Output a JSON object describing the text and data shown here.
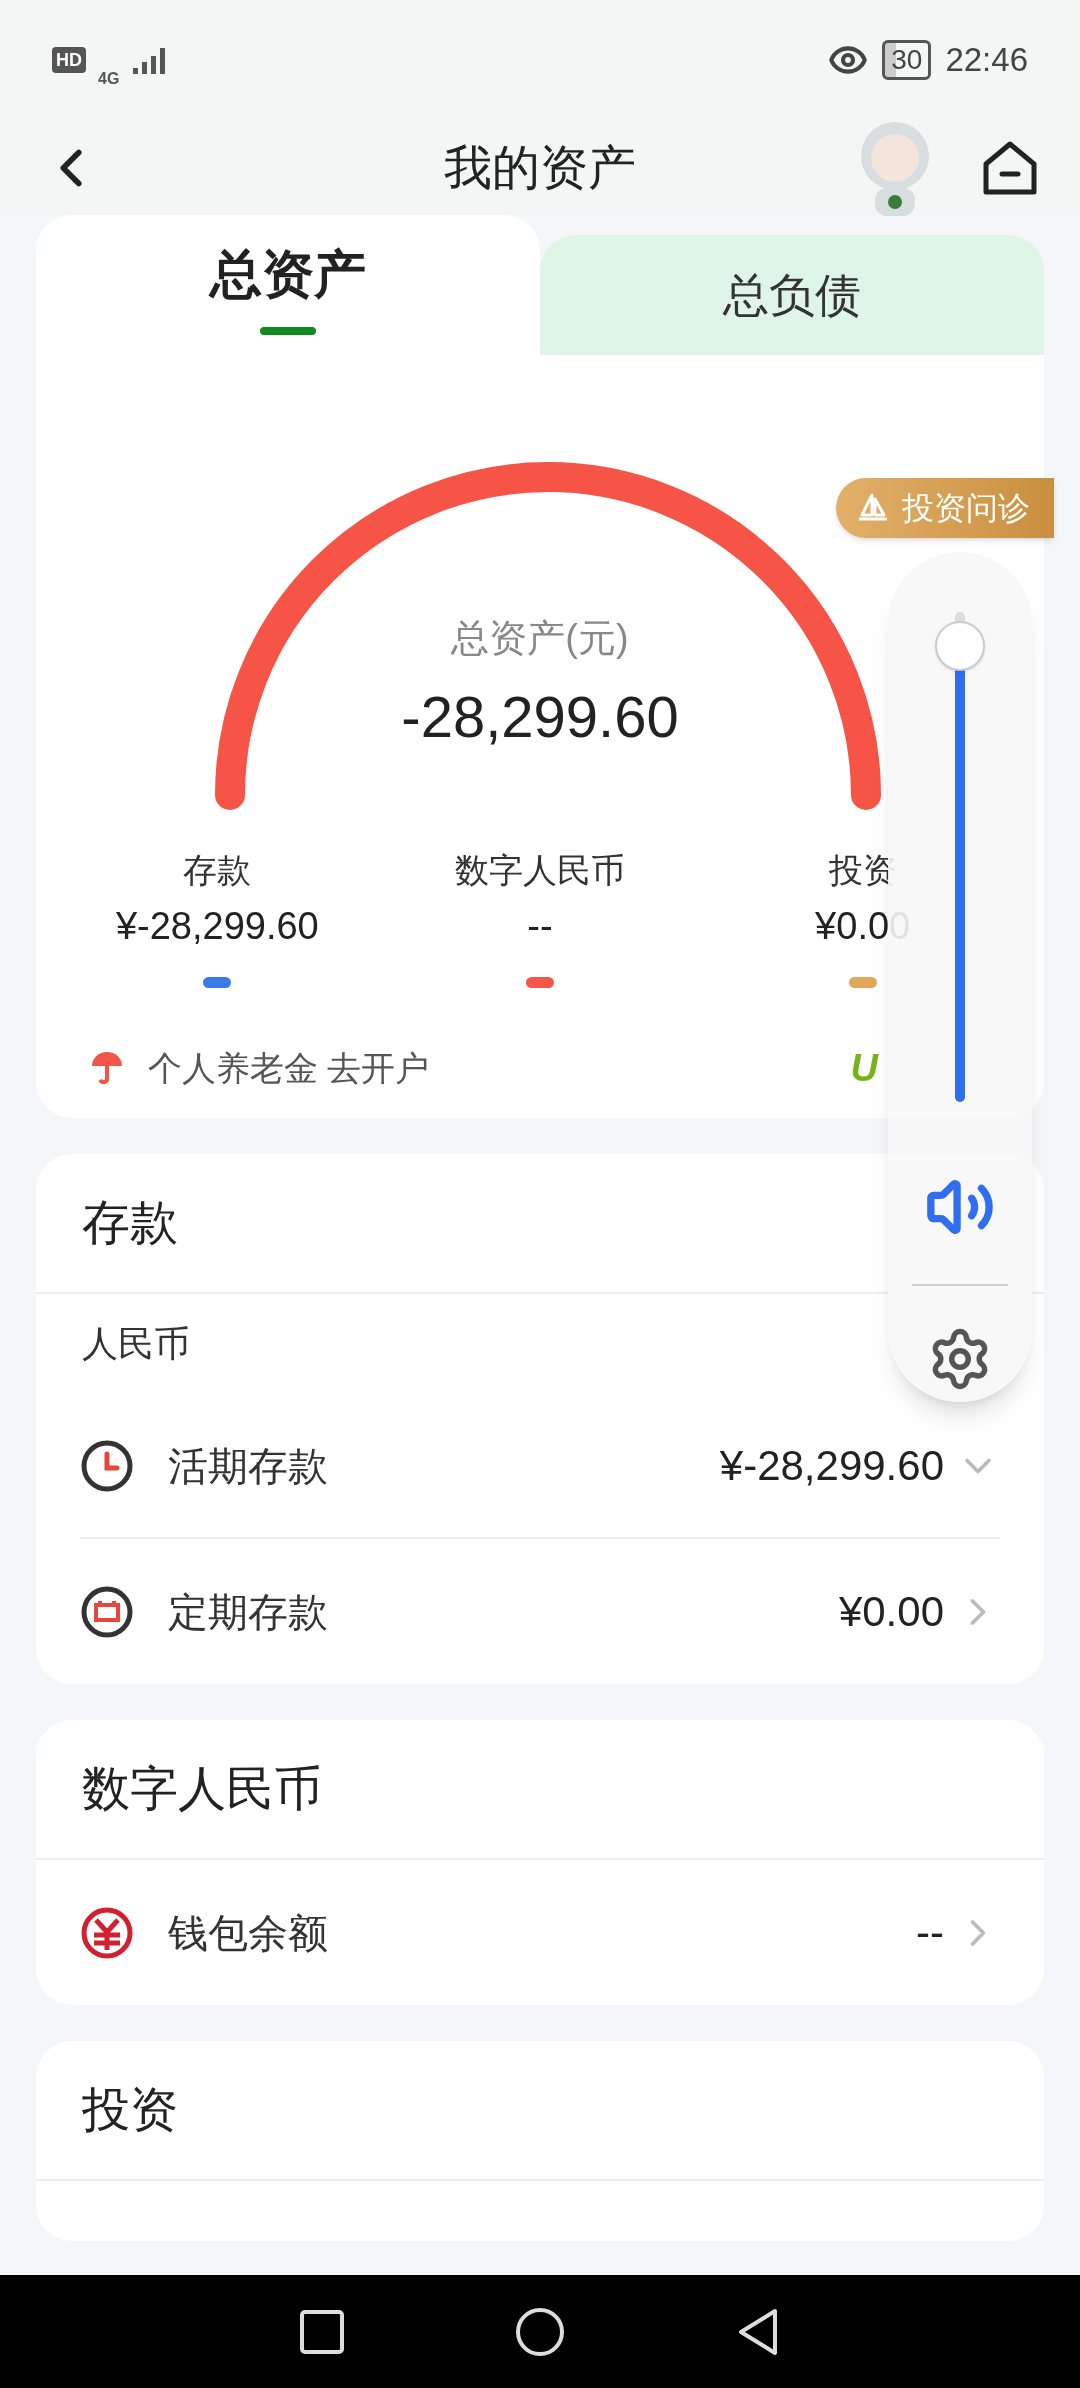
{
  "status_bar": {
    "hd": "HD",
    "network": "4G",
    "battery": "30",
    "time": "22:46"
  },
  "header": {
    "title": "我的资产"
  },
  "tabs": [
    {
      "label": "总资产",
      "selected": true
    },
    {
      "label": "总负债",
      "selected": false
    }
  ],
  "gauge": {
    "title": "总资产(元)",
    "amount": "-28,299.60"
  },
  "summary": [
    {
      "label": "存款",
      "value": "¥-28,299.60",
      "color": "#3b7be8"
    },
    {
      "label": "数字人民币",
      "value": "--",
      "color": "#f4564a"
    },
    {
      "label": "投资",
      "value": "¥0.00",
      "color": "#e0a95a"
    }
  ],
  "pension": {
    "text": "个人养老金 去开户",
    "logo": "U"
  },
  "advisor_badge": {
    "label": "投资问诊"
  },
  "volume_panel": {
    "level": 0.93
  },
  "sections": [
    {
      "title": "存款",
      "subtitle": "人民币",
      "rows": [
        {
          "kind": "clock",
          "label": "活期存款",
          "value": "¥-28,299.60",
          "expanded": true
        },
        {
          "kind": "calendar",
          "label": "定期存款",
          "value": "¥0.00",
          "expanded": false
        }
      ]
    },
    {
      "title": "数字人民币",
      "rows": [
        {
          "kind": "ecny",
          "label": "钱包余额",
          "value": "--",
          "expanded": false
        }
      ]
    },
    {
      "title": "投资"
    }
  ]
}
